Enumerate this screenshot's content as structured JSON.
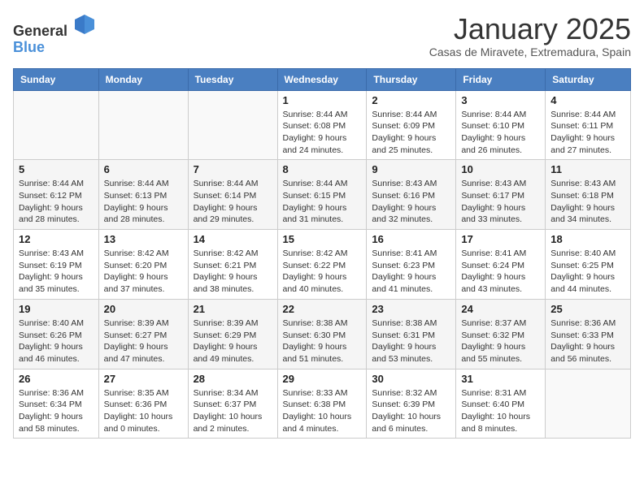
{
  "header": {
    "logo_general": "General",
    "logo_blue": "Blue",
    "month_title": "January 2025",
    "subtitle": "Casas de Miravete, Extremadura, Spain"
  },
  "weekdays": [
    "Sunday",
    "Monday",
    "Tuesday",
    "Wednesday",
    "Thursday",
    "Friday",
    "Saturday"
  ],
  "weeks": [
    [
      {
        "day": "",
        "info": ""
      },
      {
        "day": "",
        "info": ""
      },
      {
        "day": "",
        "info": ""
      },
      {
        "day": "1",
        "info": "Sunrise: 8:44 AM\nSunset: 6:08 PM\nDaylight: 9 hours\nand 24 minutes."
      },
      {
        "day": "2",
        "info": "Sunrise: 8:44 AM\nSunset: 6:09 PM\nDaylight: 9 hours\nand 25 minutes."
      },
      {
        "day": "3",
        "info": "Sunrise: 8:44 AM\nSunset: 6:10 PM\nDaylight: 9 hours\nand 26 minutes."
      },
      {
        "day": "4",
        "info": "Sunrise: 8:44 AM\nSunset: 6:11 PM\nDaylight: 9 hours\nand 27 minutes."
      }
    ],
    [
      {
        "day": "5",
        "info": "Sunrise: 8:44 AM\nSunset: 6:12 PM\nDaylight: 9 hours\nand 28 minutes."
      },
      {
        "day": "6",
        "info": "Sunrise: 8:44 AM\nSunset: 6:13 PM\nDaylight: 9 hours\nand 28 minutes."
      },
      {
        "day": "7",
        "info": "Sunrise: 8:44 AM\nSunset: 6:14 PM\nDaylight: 9 hours\nand 29 minutes."
      },
      {
        "day": "8",
        "info": "Sunrise: 8:44 AM\nSunset: 6:15 PM\nDaylight: 9 hours\nand 31 minutes."
      },
      {
        "day": "9",
        "info": "Sunrise: 8:43 AM\nSunset: 6:16 PM\nDaylight: 9 hours\nand 32 minutes."
      },
      {
        "day": "10",
        "info": "Sunrise: 8:43 AM\nSunset: 6:17 PM\nDaylight: 9 hours\nand 33 minutes."
      },
      {
        "day": "11",
        "info": "Sunrise: 8:43 AM\nSunset: 6:18 PM\nDaylight: 9 hours\nand 34 minutes."
      }
    ],
    [
      {
        "day": "12",
        "info": "Sunrise: 8:43 AM\nSunset: 6:19 PM\nDaylight: 9 hours\nand 35 minutes."
      },
      {
        "day": "13",
        "info": "Sunrise: 8:42 AM\nSunset: 6:20 PM\nDaylight: 9 hours\nand 37 minutes."
      },
      {
        "day": "14",
        "info": "Sunrise: 8:42 AM\nSunset: 6:21 PM\nDaylight: 9 hours\nand 38 minutes."
      },
      {
        "day": "15",
        "info": "Sunrise: 8:42 AM\nSunset: 6:22 PM\nDaylight: 9 hours\nand 40 minutes."
      },
      {
        "day": "16",
        "info": "Sunrise: 8:41 AM\nSunset: 6:23 PM\nDaylight: 9 hours\nand 41 minutes."
      },
      {
        "day": "17",
        "info": "Sunrise: 8:41 AM\nSunset: 6:24 PM\nDaylight: 9 hours\nand 43 minutes."
      },
      {
        "day": "18",
        "info": "Sunrise: 8:40 AM\nSunset: 6:25 PM\nDaylight: 9 hours\nand 44 minutes."
      }
    ],
    [
      {
        "day": "19",
        "info": "Sunrise: 8:40 AM\nSunset: 6:26 PM\nDaylight: 9 hours\nand 46 minutes."
      },
      {
        "day": "20",
        "info": "Sunrise: 8:39 AM\nSunset: 6:27 PM\nDaylight: 9 hours\nand 47 minutes."
      },
      {
        "day": "21",
        "info": "Sunrise: 8:39 AM\nSunset: 6:29 PM\nDaylight: 9 hours\nand 49 minutes."
      },
      {
        "day": "22",
        "info": "Sunrise: 8:38 AM\nSunset: 6:30 PM\nDaylight: 9 hours\nand 51 minutes."
      },
      {
        "day": "23",
        "info": "Sunrise: 8:38 AM\nSunset: 6:31 PM\nDaylight: 9 hours\nand 53 minutes."
      },
      {
        "day": "24",
        "info": "Sunrise: 8:37 AM\nSunset: 6:32 PM\nDaylight: 9 hours\nand 55 minutes."
      },
      {
        "day": "25",
        "info": "Sunrise: 8:36 AM\nSunset: 6:33 PM\nDaylight: 9 hours\nand 56 minutes."
      }
    ],
    [
      {
        "day": "26",
        "info": "Sunrise: 8:36 AM\nSunset: 6:34 PM\nDaylight: 9 hours\nand 58 minutes."
      },
      {
        "day": "27",
        "info": "Sunrise: 8:35 AM\nSunset: 6:36 PM\nDaylight: 10 hours\nand 0 minutes."
      },
      {
        "day": "28",
        "info": "Sunrise: 8:34 AM\nSunset: 6:37 PM\nDaylight: 10 hours\nand 2 minutes."
      },
      {
        "day": "29",
        "info": "Sunrise: 8:33 AM\nSunset: 6:38 PM\nDaylight: 10 hours\nand 4 minutes."
      },
      {
        "day": "30",
        "info": "Sunrise: 8:32 AM\nSunset: 6:39 PM\nDaylight: 10 hours\nand 6 minutes."
      },
      {
        "day": "31",
        "info": "Sunrise: 8:31 AM\nSunset: 6:40 PM\nDaylight: 10 hours\nand 8 minutes."
      },
      {
        "day": "",
        "info": ""
      }
    ]
  ]
}
